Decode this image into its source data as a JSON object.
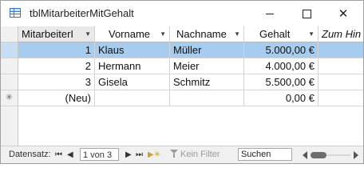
{
  "window": {
    "title": "tblMitarbeiterMitGehalt",
    "close_symbol": "✕"
  },
  "table": {
    "columns": [
      "MitarbeiterI",
      "Vorname",
      "Nachname",
      "Gehalt",
      "Zum Hin"
    ],
    "rows": [
      {
        "id": "1",
        "vorname": "Klaus",
        "nachname": "Müller",
        "gehalt": "5.000,00 €"
      },
      {
        "id": "2",
        "vorname": "Hermann",
        "nachname": "Meier",
        "gehalt": "4.000,00 €"
      },
      {
        "id": "3",
        "vorname": "Gisela",
        "nachname": "Schmitz",
        "gehalt": "5.500,00 €"
      }
    ],
    "new_row": {
      "marker": "✳",
      "id": "(Neu)",
      "gehalt": "0,00 €"
    },
    "current_row": 0
  },
  "statusbar": {
    "label": "Datensatz:",
    "position": "1 von 3",
    "filter_label": "Kein Filter",
    "search_placeholder": "Suchen",
    "nav": {
      "first": "⏮",
      "prev": "◀",
      "next": "▶",
      "last": "⏭",
      "new": "▶✳"
    }
  },
  "colors": {
    "selected_row": "#a6cdf0",
    "accent": "#3a76c4"
  }
}
